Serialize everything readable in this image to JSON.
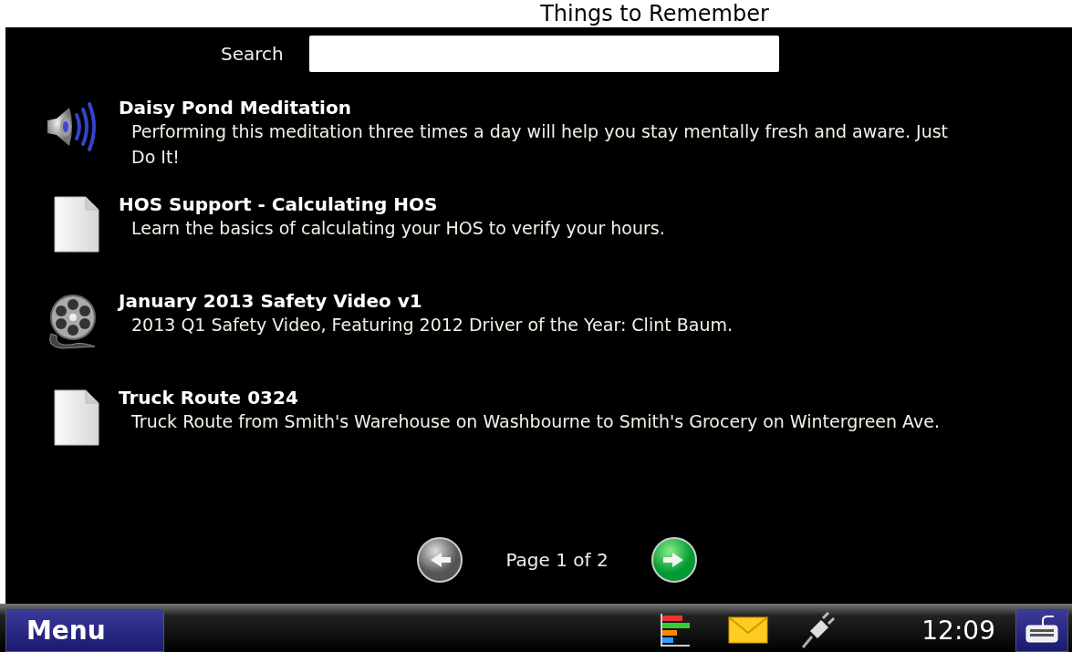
{
  "window": {
    "title": "Things to Remember"
  },
  "search": {
    "label": "Search"
  },
  "items": [
    {
      "kind": "audio",
      "title": "Daisy Pond Meditation",
      "description": "Performing this meditation three times a day will help you stay mentally fresh and aware. Just Do It!"
    },
    {
      "kind": "document",
      "title": "HOS Support - Calculating HOS",
      "description": "Learn the basics of calculating your HOS to verify your hours."
    },
    {
      "kind": "video",
      "title": "January 2013 Safety Video v1",
      "description": "2013 Q1 Safety Video, Featuring 2012 Driver of the Year: Clint Baum."
    },
    {
      "kind": "document",
      "title": "Truck Route 0324",
      "description": "Truck Route from Smith's Warehouse on Washbourne to Smith's Grocery on Wintergreen Ave."
    }
  ],
  "pager": {
    "text": "Page 1 of 2",
    "previous": {
      "disabled": true
    },
    "next": {
      "disabled": false
    }
  },
  "taskbar": {
    "menu": "Menu",
    "time": "12:09"
  }
}
